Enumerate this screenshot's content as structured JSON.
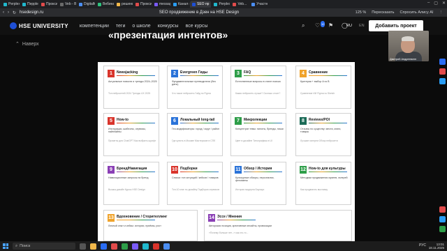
{
  "browser": {
    "tabs": [
      {
        "label": "Perplexity",
        "color": "#20b8cd"
      },
      {
        "label": "Перplexity",
        "color": "#20b8cd"
      },
      {
        "label": "Прокси",
        "color": "#e14b4b"
      },
      {
        "label": "Veb - Booc",
        "color": "#6a6a6a"
      },
      {
        "label": "Digitalfer",
        "color": "#4b8ef2"
      },
      {
        "label": "Вебинары",
        "color": "#2ec27e"
      },
      {
        "label": "решение по",
        "color": "#f2b84b"
      },
      {
        "label": "Прокси",
        "color": "#e14b4b"
      },
      {
        "label": "messager",
        "color": "#7a5af8"
      },
      {
        "label": "Канал по",
        "color": "#2a9df4"
      },
      {
        "label": "SEO пр",
        "color": "#1e4fd6",
        "active": true
      },
      {
        "label": "Perplexity",
        "color": "#20b8cd"
      },
      {
        "label": "Veb...",
        "color": "#e14b4b"
      },
      {
        "label": "Участник",
        "color": "#4b8ef2"
      }
    ],
    "url": "hsedesign.ru",
    "page_title": "SEO продвижение в Дзен на HSE Design",
    "zoom": "125 %",
    "actions": [
      "Пересказать",
      "Спросить Алису AI"
    ]
  },
  "site": {
    "logo_text": "HSE UNIVERSITY",
    "nav": [
      "компетенции",
      "теги",
      "о школе",
      "конкурсы",
      "все курсы"
    ],
    "badge": "10",
    "lang_active": "RU",
    "lang_other": "EN",
    "cta": "Добавить проект",
    "back": "Наверх"
  },
  "slide": {
    "heading": "«презентация интентов»",
    "cards": [
      {
        "n": "1",
        "title": "Newsjacking",
        "color": "#d9342b",
        "desc": "Актуальные новости и тренды 2024–2025",
        "ex": "Топ нейросетей 2024 Тренды UX 2025"
      },
      {
        "n": "2",
        "title": "Evergreen Гиды",
        "color": "#2a73d9",
        "desc": "Фундаментальные путеводители (без даты)",
        "ex": "Что такое нейросеть Гайд по Figma"
      },
      {
        "n": "3",
        "title": "FAQ",
        "color": "#2e9e49",
        "desc": "Естественные вопросы в стиле поиска",
        "ex": "Какая нейросеть лучше? Сколько стоит?"
      },
      {
        "n": "4",
        "title": "Сравнение",
        "color": "#f0a32b",
        "desc": "Критерии + выбор A vs B",
        "ex": "Сравнение ИИ Figma vs Sketch"
      },
      {
        "n": "5",
        "title": "How-to",
        "color": "#d9342b",
        "desc": "Инструкции, шаблоны, сервисы, пайплайны",
        "ex": "Промпты для ChatGPT Как выбрать шрифт"
      },
      {
        "n": "6",
        "title": "Локальный long-tail",
        "color": "#2a73d9",
        "desc": "Гео-модификаторы: город / округ / район",
        "ex": "Где купить в Москве Мастерские в СПб"
      },
      {
        "n": "7",
        "title": "Микролекции",
        "color": "#2e9e49",
        "desc": "Концентрат темы: пилоты, бренды, ниши",
        "ex": "Цвет в дизайне Типографика в UI"
      },
      {
        "n": "8",
        "title": "Reviews/POI",
        "color": "#1b6b57",
        "desc": "Отзывы по существу: места, книги, товары",
        "ex": "Лучшие галереи Обзор нейросети"
      },
      {
        "n": "9",
        "title": "Бренд/Навигация",
        "color": "#8a3fb5",
        "desc": "Навигационные запросы на бренд",
        "ex": "Вышка дизайн Курсы HSE Design"
      },
      {
        "n": "10",
        "title": "Подборки",
        "color": "#d9342b",
        "desc": "Списки: топ ситуаций / кейсов / товаров",
        "ex": "Топ-10 книг по дизайну Подборка сервисов"
      },
      {
        "n": "11",
        "title": "Обзор / История",
        "color": "#2a73d9",
        "desc": "Культурные обзоры, персоналии, феномены",
        "ex": "История модерна Баухаус"
      },
      {
        "n": "12",
        "title": "How-to для культуры",
        "color": "#2e9e49",
        "desc": "Методики продвижения музеев, галерей",
        "ex": "Как продвигать выставку"
      },
      {
        "n": "13",
        "title": "Вдохновение / Сторителлинг",
        "color": "#f0a32b",
        "desc": "Личный опыт и кейсы: истории, приёмы, рост",
        "ex": ""
      },
      {
        "n": "14",
        "title": "Эссе / Мнения",
        "color": "#8a3fb5",
        "desc": "Авторская позиция, креативные инсайты, провокации",
        "ex": "«Почему больше нет...» как кто-то..."
      }
    ]
  },
  "video": {
    "name": "Дмитрий Андреевинн"
  },
  "taskbar": {
    "search_placeholder": "Поиск",
    "time": "13:01",
    "date": "18.11.2025",
    "lang": "РУС"
  }
}
